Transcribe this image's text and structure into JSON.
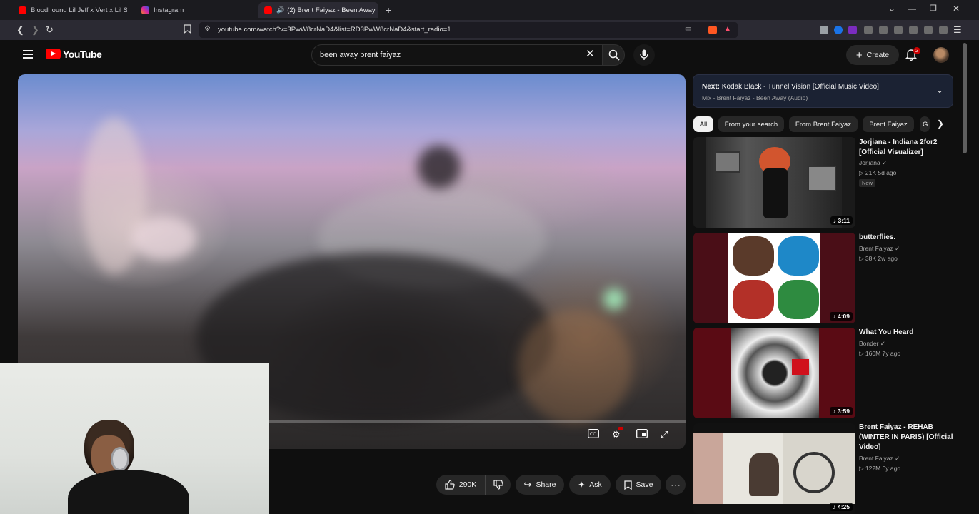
{
  "browser": {
    "tabs": [
      {
        "label": "Bloodhound Lil Jeff x Vert x Lil Scoom",
        "favicon_color": "#ff0000"
      },
      {
        "label": "Instagram",
        "favicon_color": "#d6249f"
      },
      {
        "label": "(2) Brent Faiyaz - Been Away",
        "favicon_color": "#ff0000"
      }
    ],
    "new_tab": "+",
    "url": "youtube.com/watch?v=3PwW8crNaD4&list=RD3PwW8crNaD4&start_radio=1"
  },
  "youtube": {
    "logo_text": "YouTube",
    "search_value": "been away brent faiyaz",
    "create_label": "Create",
    "notification_count": "2"
  },
  "actions": {
    "like_count": "290K",
    "share_label": "Share",
    "ask_label": "Ask",
    "save_label": "Save"
  },
  "up_next": {
    "prefix": "Next:",
    "title": "Kodak Black - Tunnel Vision [Official Music Video]",
    "subtitle": "Mix - Brent Faiyaz - Been Away (Audio)"
  },
  "chips": [
    "All",
    "From your search",
    "From Brent Faiyaz",
    "Brent Faiyaz",
    "G"
  ],
  "videos": [
    {
      "title": "Jorjiana - Indiana 2for2 [Official Visualizer]",
      "channel": "Jorjiana",
      "stats": "21K  5d ago",
      "badge": "New",
      "duration": "3:11"
    },
    {
      "title": "butterflies.",
      "channel": "Brent Faiyaz",
      "stats": "38K  2w ago",
      "badge": "",
      "duration": "4:09"
    },
    {
      "title": "What You Heard",
      "channel": "Bonder",
      "stats": "160M  7y ago",
      "badge": "",
      "duration": "3:59"
    },
    {
      "title": "Brent Faiyaz - REHAB (WINTER IN PARIS) [Official Video]",
      "channel": "Brent Faiyaz",
      "stats": "122M  6y ago",
      "badge": "",
      "duration": "4:25"
    }
  ],
  "colors": {
    "accent_red": "#ff0000",
    "chip_selected": "#f1f1f1",
    "surface": "#272727"
  }
}
